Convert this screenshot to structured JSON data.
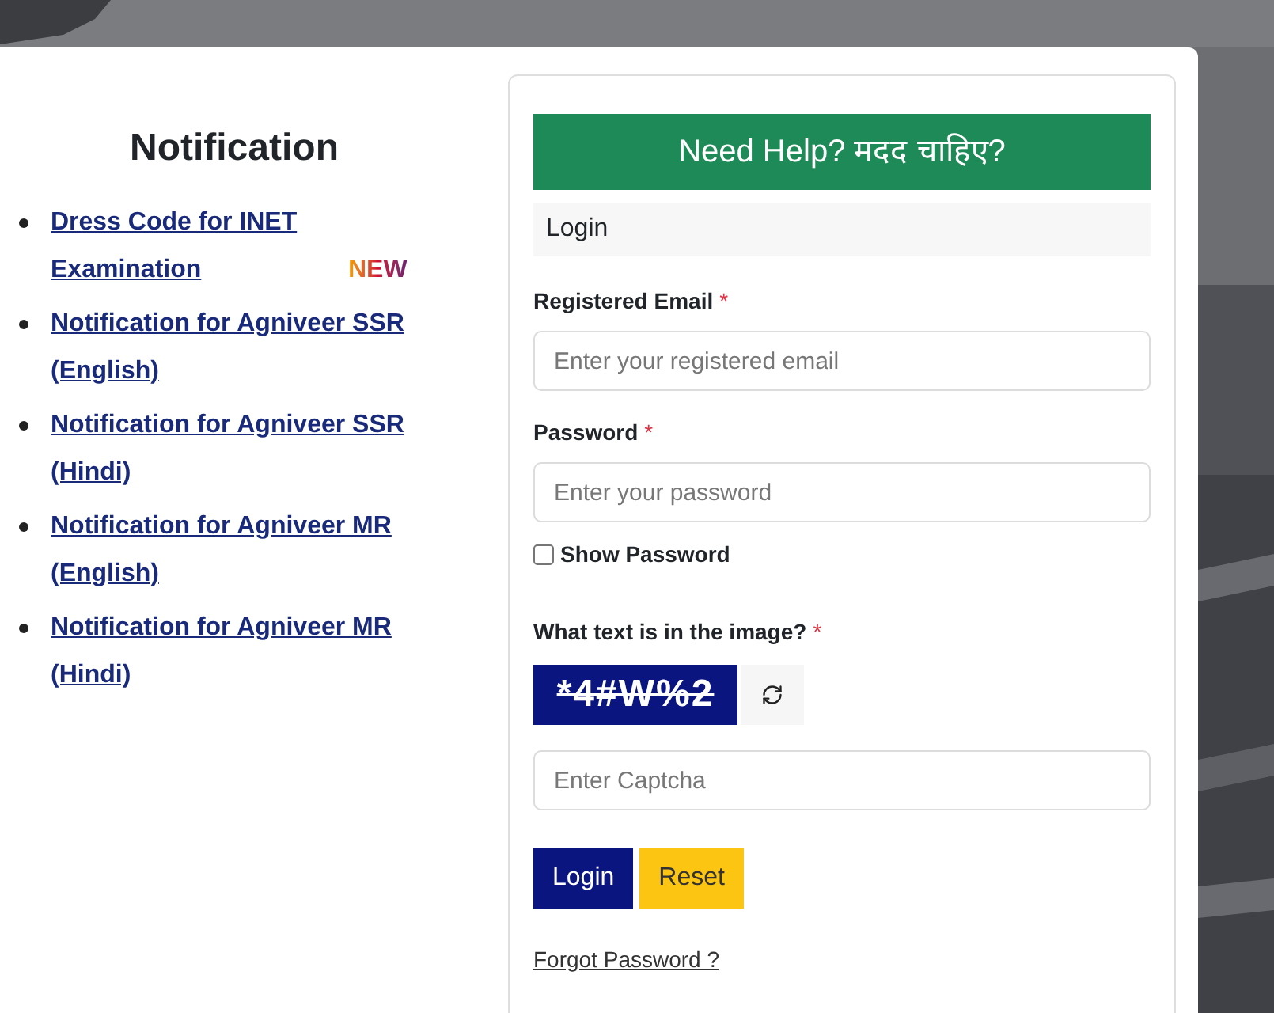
{
  "notification": {
    "title": "Notification",
    "items": [
      {
        "text": "Dress Code for INET Examination ",
        "badge": "NEW"
      },
      {
        "text": "Notification for Agniveer SSR (English)"
      },
      {
        "text": "Notification for Agniveer SSR (Hindi)"
      },
      {
        "text": "Notification for Agniveer MR (English)"
      },
      {
        "text": "Notification for Agniveer MR (Hindi)"
      }
    ]
  },
  "login": {
    "help_button": "Need Help? मदद चाहिए?",
    "header": "Login",
    "email": {
      "label": "Registered Email",
      "required": "*",
      "placeholder": "Enter your registered email"
    },
    "password": {
      "label": "Password",
      "required": "*",
      "placeholder": "Enter your password"
    },
    "show_password": {
      "label": "Show Password",
      "checked": false
    },
    "captcha": {
      "label": "What text is in the image?",
      "required": "*",
      "image_text": "*4#W%2",
      "placeholder": "Enter Captcha"
    },
    "buttons": [
      {
        "kind": "primary",
        "label": "Login"
      },
      {
        "kind": "secondary",
        "label": "Reset"
      }
    ],
    "forgot_link": "Forgot Password ?"
  }
}
